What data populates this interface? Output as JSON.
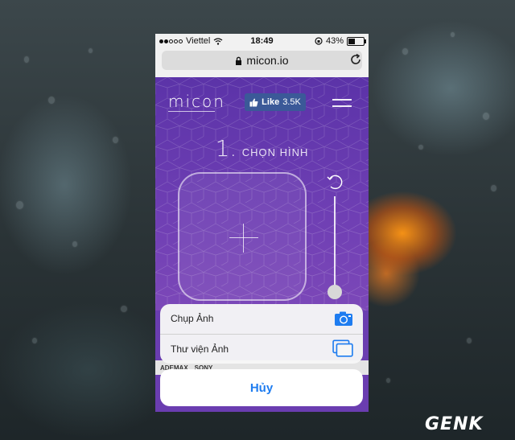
{
  "status_bar": {
    "carrier": "Viettel",
    "time": "18:49",
    "battery": "43%"
  },
  "url_bar": {
    "url": "micon.io"
  },
  "site": {
    "logo": "micon",
    "like_label": "Like",
    "like_count": "3.5K",
    "step_number": "1.",
    "step_label": "CHỌN HÌNH"
  },
  "ad_strip": {
    "brand_1": "ADEMAX",
    "brand_2": "SONY"
  },
  "action_sheet": {
    "options": [
      {
        "label": "Chụp Ảnh",
        "icon": "camera-icon"
      },
      {
        "label": "Thư viện Ảnh",
        "icon": "photo-library-icon"
      }
    ],
    "cancel_label": "Hủy"
  },
  "watermark": "GENK",
  "colors": {
    "site_purple": "#6a3db0",
    "ios_blue": "#1e7cf0",
    "facebook_blue": "#3b5998"
  }
}
